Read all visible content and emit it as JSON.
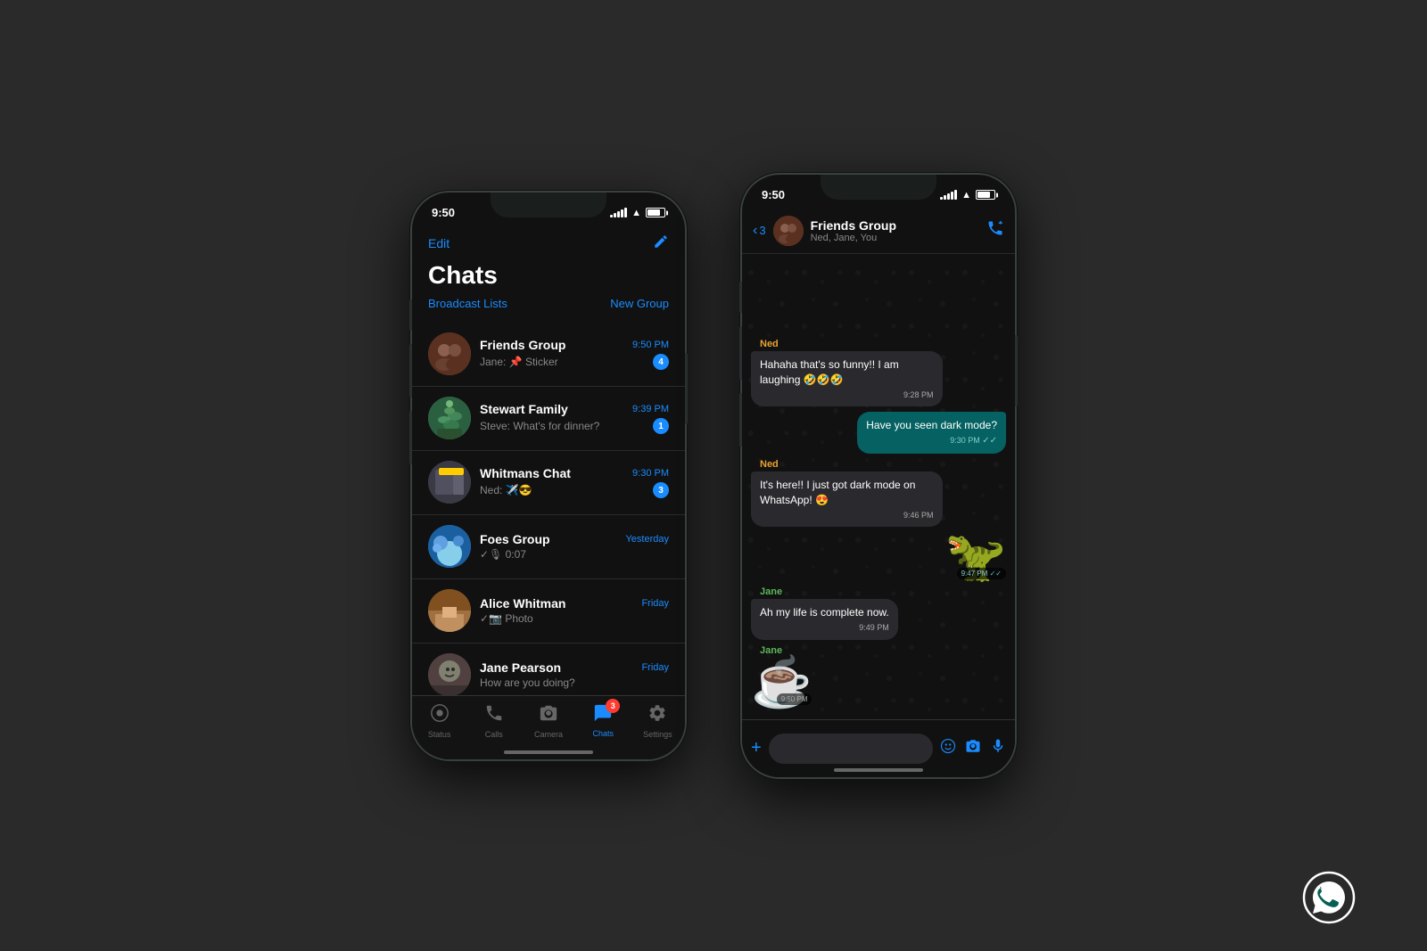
{
  "background": "#2a2a2a",
  "phone1": {
    "statusBar": {
      "time": "9:50",
      "signal": [
        3,
        5,
        7,
        9,
        11
      ],
      "wifi": true,
      "battery": 75
    },
    "header": {
      "editLabel": "Edit",
      "composeIcon": "✎",
      "title": "Chats",
      "broadcastLists": "Broadcast Lists",
      "newGroup": "New Group"
    },
    "chats": [
      {
        "id": "friends-group",
        "name": "Friends Group",
        "time": "9:50 PM",
        "preview": "Jane: 📌 Sticker",
        "badge": "4",
        "avatarClass": "avatar-friends",
        "avatarEmoji": ""
      },
      {
        "id": "stewart-family",
        "name": "Stewart Family",
        "time": "9:39 PM",
        "preview": "Steve: What's for dinner?",
        "badge": "1",
        "avatarClass": "avatar-stewart",
        "avatarEmoji": ""
      },
      {
        "id": "whitmans-chat",
        "name": "Whitmans Chat",
        "time": "9:30 PM",
        "preview": "Ned: ✈️😎",
        "badge": "3",
        "avatarClass": "avatar-whitmans",
        "avatarEmoji": ""
      },
      {
        "id": "foes-group",
        "name": "Foes Group",
        "time": "Yesterday",
        "preview": "✓🎙 0:07",
        "badge": "",
        "avatarClass": "avatar-foes",
        "avatarEmoji": ""
      },
      {
        "id": "alice-whitman",
        "name": "Alice Whitman",
        "time": "Friday",
        "preview": "✓📷 Photo",
        "badge": "",
        "avatarClass": "avatar-alice",
        "avatarEmoji": ""
      },
      {
        "id": "jane-pearson",
        "name": "Jane Pearson",
        "time": "Friday",
        "preview": "How are you doing?",
        "badge": "",
        "avatarClass": "avatar-jane",
        "avatarEmoji": ""
      }
    ],
    "tabBar": {
      "tabs": [
        {
          "id": "status",
          "icon": "◎",
          "label": "Status",
          "active": false
        },
        {
          "id": "calls",
          "icon": "📞",
          "label": "Calls",
          "active": false
        },
        {
          "id": "camera",
          "icon": "📷",
          "label": "Camera",
          "active": false
        },
        {
          "id": "chats",
          "icon": "💬",
          "label": "Chats",
          "active": true,
          "badge": "3"
        },
        {
          "id": "settings",
          "icon": "⚙",
          "label": "Settings",
          "active": false
        }
      ]
    }
  },
  "phone2": {
    "statusBar": {
      "time": "9:50",
      "signal": [
        3,
        5,
        7,
        9,
        11
      ],
      "wifi": true,
      "battery": 75
    },
    "header": {
      "backCount": "3",
      "groupName": "Friends Group",
      "members": "Ned, Jane, You",
      "callIcon": "📞+"
    },
    "messages": [
      {
        "id": "msg1",
        "type": "incoming",
        "sender": "Ned",
        "senderColor": "ned",
        "text": "Hahaha that's so funny!! I am laughing 🤣🤣🤣",
        "time": "9:28 PM"
      },
      {
        "id": "msg2",
        "type": "outgoing",
        "text": "Have you seen dark mode?",
        "time": "9:30 PM",
        "ticks": "✓✓"
      },
      {
        "id": "msg3",
        "type": "incoming",
        "sender": "Ned",
        "senderColor": "ned",
        "text": "It's here!! I just got dark mode on WhatsApp! 😍",
        "time": "9:46 PM"
      },
      {
        "id": "msg4",
        "type": "outgoing-sticker",
        "emoji": "🦖",
        "time": "9:47 PM",
        "ticks": "✓✓"
      },
      {
        "id": "msg5",
        "type": "incoming",
        "sender": "Jane",
        "senderColor": "jane",
        "text": "Ah my life is complete now.",
        "time": "9:49 PM"
      },
      {
        "id": "msg6",
        "type": "incoming-sticker",
        "sender": "Jane",
        "senderColor": "jane",
        "emoji": "☕",
        "time": "9:50 PM"
      }
    ],
    "inputBar": {
      "plusIcon": "+",
      "placeholder": "",
      "stickerIcon": "◉",
      "cameraIcon": "📷",
      "micIcon": "🎤"
    }
  },
  "whatsappLogo": {
    "visible": true
  }
}
